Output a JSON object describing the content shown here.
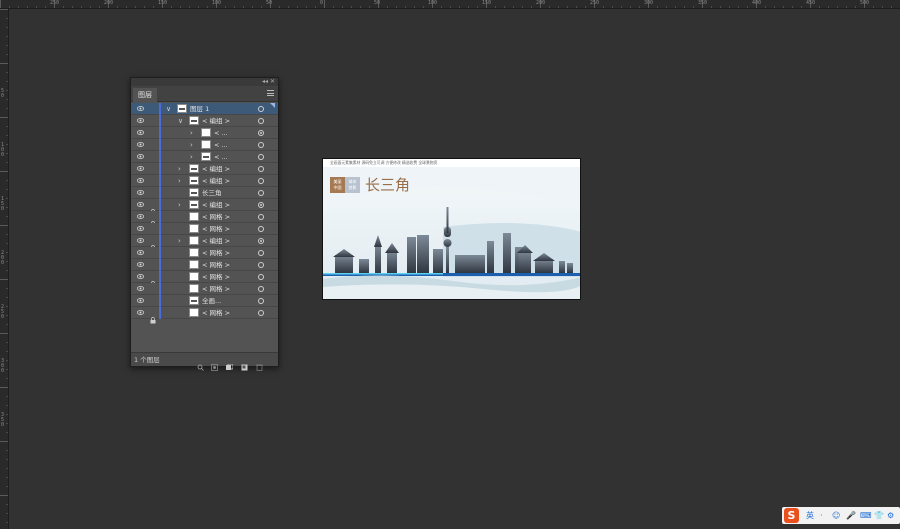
{
  "ruler_top_labels": [
    "250",
    "200",
    "150",
    "100",
    "50",
    "0",
    "50",
    "100",
    "150",
    "200",
    "250",
    "300",
    "350",
    "400",
    "450",
    "500"
  ],
  "ruler_left_labels": [
    "50",
    "100",
    "150",
    "200",
    "250",
    "300",
    "350"
  ],
  "layers_panel": {
    "tab_label": "图层",
    "collapse_glyph": "◂◂",
    "close_glyph": "✕",
    "footer_count": "1 个图层",
    "rows": [
      {
        "name": "图层 1",
        "indent": 0,
        "arrow": "∨",
        "selected": true,
        "lock": false,
        "thumb": "dark",
        "target": "empty"
      },
      {
        "name": "< 编组 >",
        "indent": 1,
        "arrow": "∨",
        "selected": false,
        "lock": false,
        "thumb": "dark",
        "target": "empty"
      },
      {
        "name": "< ...",
        "indent": 2,
        "arrow": "›",
        "selected": false,
        "lock": false,
        "thumb": "plain",
        "target": "filled"
      },
      {
        "name": "< ...",
        "indent": 2,
        "arrow": "›",
        "selected": false,
        "lock": false,
        "thumb": "plain",
        "target": "empty"
      },
      {
        "name": "< ...",
        "indent": 2,
        "arrow": "›",
        "selected": false,
        "lock": false,
        "thumb": "dark",
        "target": "empty"
      },
      {
        "name": "< 编组 >",
        "indent": 1,
        "arrow": "›",
        "selected": false,
        "lock": false,
        "thumb": "dark",
        "target": "empty"
      },
      {
        "name": "< 编组 >",
        "indent": 1,
        "arrow": "›",
        "selected": false,
        "lock": false,
        "thumb": "dark",
        "target": "empty"
      },
      {
        "name": "长三角",
        "indent": 1,
        "arrow": "",
        "selected": false,
        "lock": false,
        "thumb": "dark",
        "target": "empty"
      },
      {
        "name": "< 编组 >",
        "indent": 1,
        "arrow": "›",
        "selected": false,
        "lock": true,
        "thumb": "dark",
        "target": "filled"
      },
      {
        "name": "< 网格 >",
        "indent": 1,
        "arrow": "",
        "selected": false,
        "lock": true,
        "thumb": "plain",
        "target": "empty"
      },
      {
        "name": "< 网格 >",
        "indent": 1,
        "arrow": "",
        "selected": false,
        "lock": false,
        "thumb": "plain",
        "target": "empty"
      },
      {
        "name": "< 编组 >",
        "indent": 1,
        "arrow": "›",
        "selected": false,
        "lock": true,
        "thumb": "plain",
        "target": "filled"
      },
      {
        "name": "< 网格 >",
        "indent": 1,
        "arrow": "",
        "selected": false,
        "lock": false,
        "thumb": "plain",
        "target": "empty"
      },
      {
        "name": "< 网格 >",
        "indent": 1,
        "arrow": "",
        "selected": false,
        "lock": false,
        "thumb": "plain",
        "target": "empty"
      },
      {
        "name": "< 网格 >",
        "indent": 1,
        "arrow": "",
        "selected": false,
        "lock": true,
        "thumb": "plain",
        "target": "empty"
      },
      {
        "name": "< 网格 >",
        "indent": 1,
        "arrow": "",
        "selected": false,
        "lock": false,
        "thumb": "plain",
        "target": "empty"
      },
      {
        "name": "全画...",
        "indent": 1,
        "arrow": "",
        "selected": false,
        "lock": false,
        "thumb": "dark",
        "target": "empty"
      },
      {
        "name": "< 网格 >",
        "indent": 1,
        "arrow": "",
        "selected": false,
        "lock": true,
        "thumb": "plain",
        "target": "empty"
      }
    ]
  },
  "artboard": {
    "top_text": "全画面元素集素材  源码免立可调  方便修改  精选收费  全球景物资",
    "badge_left": "美丽\n中国",
    "badge_right": "城市\n剪影",
    "title": "长三角"
  },
  "ime": {
    "logo": "S",
    "lang": "英",
    "items": [
      "·",
      "☺",
      "🎤",
      "⌨",
      "👕",
      "⚙"
    ]
  },
  "colors": {
    "workspace": "#323232",
    "panel": "#535353",
    "selected_row": "#3d5a78",
    "layer_color_bar": "#4a6bd8",
    "title_brown": "#9a6e48",
    "ime_red": "#e8501e"
  }
}
